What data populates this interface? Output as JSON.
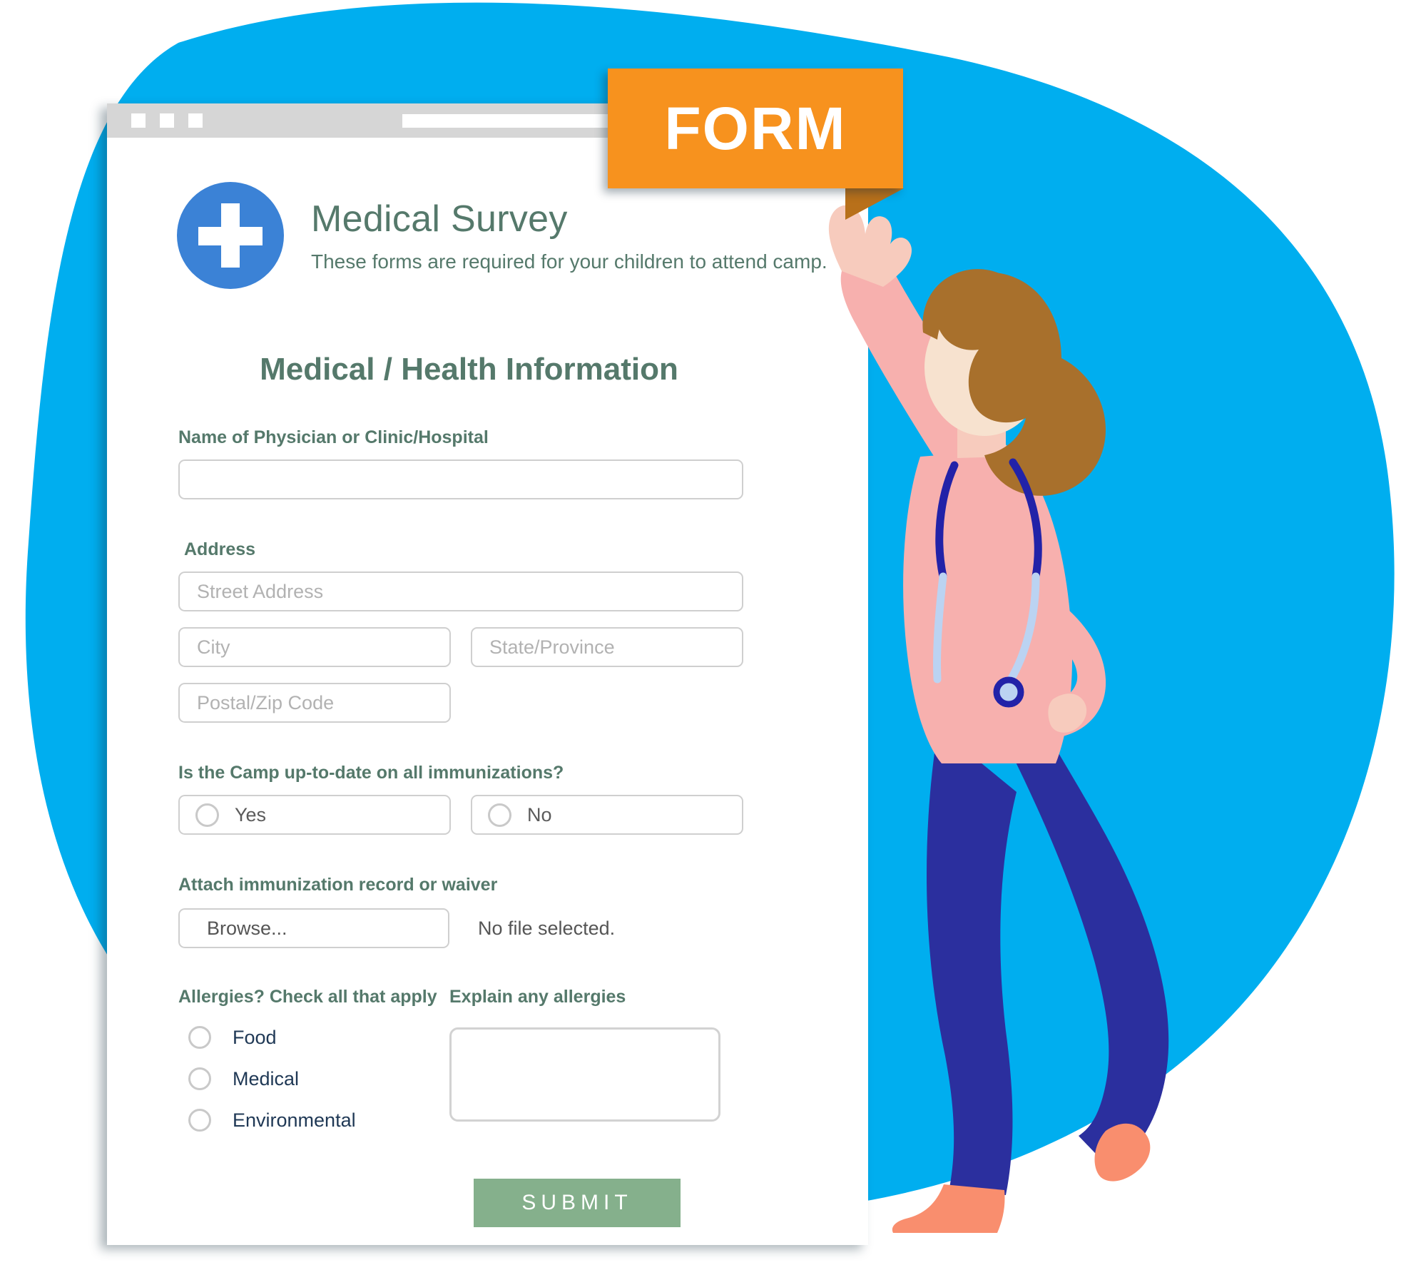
{
  "colors": {
    "blob_blue": "#00AEEF",
    "banner_orange": "#F7921E",
    "banner_tail_orange": "#B8701A",
    "badge_blue": "#3B82D6",
    "heading_green": "#55796B",
    "submit_green": "#85B08C",
    "input_border": "#CFCFCF",
    "placeholder_gray": "#B2B2B2",
    "checkbox_label_navy": "#1F3855",
    "chrome_gray": "#D6D6D6",
    "skin_pink": "#F7B0AE",
    "hair_brown": "#A8702C",
    "pants_navy": "#2B2F9E",
    "shoe_coral": "#F98E6E",
    "stethoscope_navy": "#2222A8"
  },
  "banner": {
    "label": "FORM"
  },
  "browser": {
    "dots": [
      "dot-1",
      "dot-2",
      "dot-3"
    ],
    "urlbar_value": ""
  },
  "header": {
    "logo_icon": "medical-cross-icon",
    "title": "Medical Survey",
    "subtitle": "These forms are required for your children to attend camp."
  },
  "section": {
    "title": "Medical / Health Information"
  },
  "fields": {
    "physician": {
      "label": "Name of Physician or Clinic/Hospital",
      "value": "",
      "placeholder": ""
    },
    "address": {
      "label": "Address",
      "street": {
        "placeholder": "Street Address",
        "value": ""
      },
      "city": {
        "placeholder": "City",
        "value": ""
      },
      "state": {
        "placeholder": "State/Province",
        "value": ""
      },
      "postal": {
        "placeholder": "Postal/Zip Code",
        "value": ""
      }
    },
    "immunization": {
      "label": "Is the Camp up-to-date on all immunizations?",
      "options": [
        {
          "label": "Yes",
          "selected": false
        },
        {
          "label": "No",
          "selected": false
        }
      ]
    },
    "attachment": {
      "label": "Attach immunization record or waiver",
      "button_label": "Browse...",
      "status": "No file selected."
    },
    "allergies": {
      "label": "Allergies? Check all that apply",
      "options": [
        {
          "label": "Food",
          "checked": false
        },
        {
          "label": "Medical",
          "checked": false
        },
        {
          "label": "Environmental",
          "checked": false
        }
      ],
      "explain_label": "Explain any allergies",
      "explain_value": "",
      "explain_placeholder": ""
    }
  },
  "actions": {
    "submit_label": "SUBMIT"
  }
}
